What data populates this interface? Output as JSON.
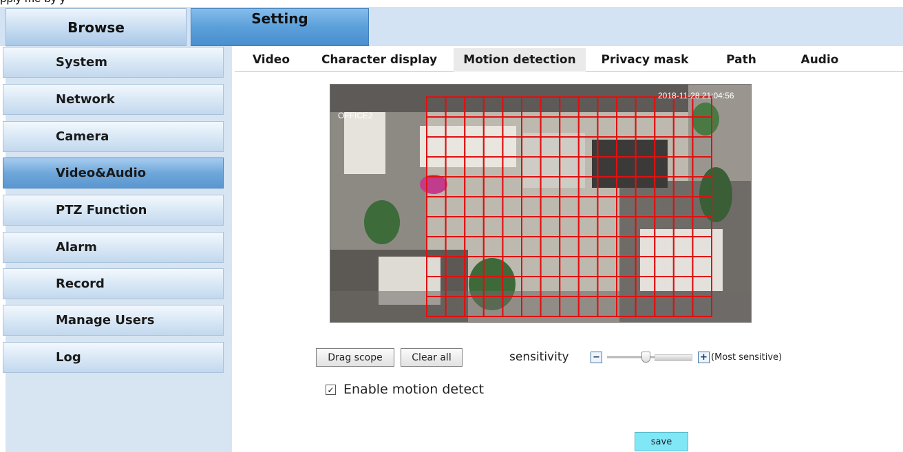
{
  "page": {
    "top_text": "pply me     by           y"
  },
  "top_tabs": {
    "browse": "Browse",
    "setting": "Setting"
  },
  "sidebar": {
    "items": [
      {
        "label": "System"
      },
      {
        "label": "Network"
      },
      {
        "label": "Camera"
      },
      {
        "label": "Video&Audio"
      },
      {
        "label": "PTZ Function"
      },
      {
        "label": "Alarm"
      },
      {
        "label": "Record"
      },
      {
        "label": "Manage Users"
      },
      {
        "label": "Log"
      }
    ],
    "active": "Video&Audio"
  },
  "sub_tabs": {
    "items": [
      {
        "label": "Video"
      },
      {
        "label": "Character display"
      },
      {
        "label": "Motion detection"
      },
      {
        "label": "Privacy mask"
      },
      {
        "label": "Path"
      },
      {
        "label": "Audio"
      }
    ],
    "active": "Motion detection"
  },
  "video": {
    "camera_name": "OFFICE2",
    "timestamp": "2018-11-28  21:04:56",
    "grid_color": "#e01010"
  },
  "controls": {
    "drag_scope": "Drag scope",
    "clear_all": "Clear all",
    "sensitivity_label": "sensitivity",
    "minus_icon": "−",
    "plus_icon": "+",
    "most_sensitive": "(Most sensitive)",
    "sensitivity_level": 0.45,
    "enable_label": "Enable motion detect",
    "enable_checked": true,
    "checkmark": "✓",
    "save": "save"
  },
  "colors": {
    "header_bg": "#d3e3f4",
    "setting_tab": "#5b9fda",
    "active_nav": "#6fa7da",
    "save_button": "#80e7f7"
  }
}
